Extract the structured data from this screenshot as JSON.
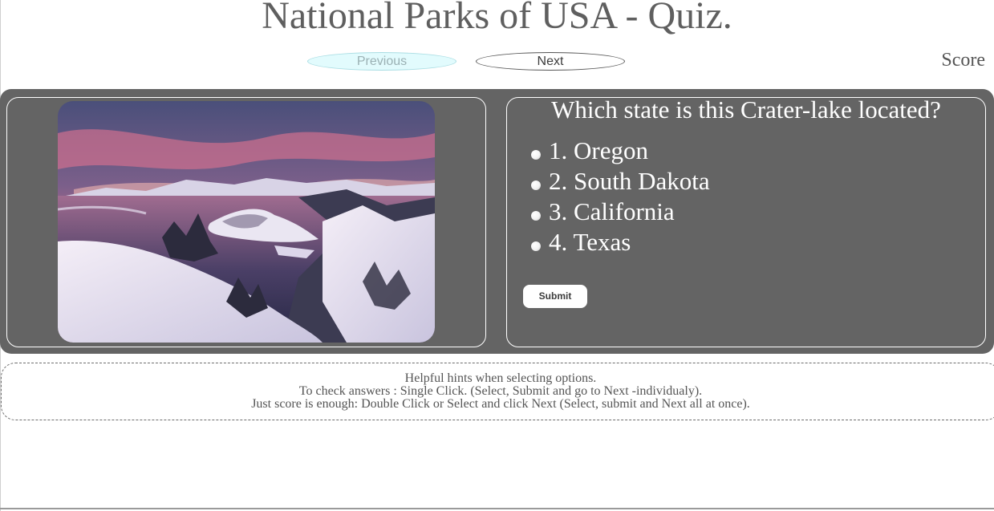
{
  "page": {
    "title": "National Parks of USA - Quiz."
  },
  "nav": {
    "previous_label": "Previous",
    "next_label": "Next",
    "score_label": "Score"
  },
  "quiz": {
    "question": "Which state is this Crater-lake located?",
    "options": [
      {
        "label": "1. Oregon"
      },
      {
        "label": "2. South Dakota"
      },
      {
        "label": "3. California"
      },
      {
        "label": "4. Texas"
      }
    ],
    "submit_label": "Submit",
    "image": "crater-lake-photo"
  },
  "hints": {
    "lines": [
      "Helpful hints when selecting options.",
      "To check answers : Single Click. (Select, Submit and go to Next -individualy).",
      "Just score is enough: Double Click or Select and click Next (Select, submit and Next all at once)."
    ]
  },
  "colors": {
    "panel": "#646464",
    "title": "#5f5f5f",
    "previous_button": "#e2fbfd",
    "text_on_panel": "#ffffff"
  }
}
